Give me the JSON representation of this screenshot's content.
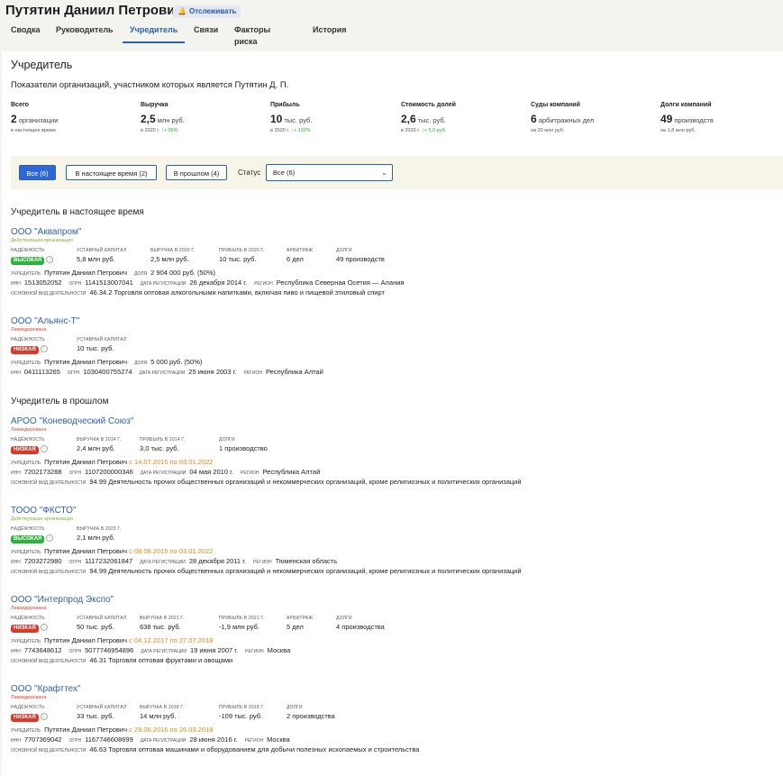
{
  "header": {
    "person_name": "Путятин Даниил Петрович",
    "follow_label": "Отслеживать"
  },
  "tabs": [
    {
      "label": "Сводка"
    },
    {
      "label": "Руководитель"
    },
    {
      "label": "Учредитель"
    },
    {
      "label": "Связи"
    },
    {
      "label": "Факторы риска"
    },
    {
      "label": "История"
    }
  ],
  "main": {
    "title": "Учредитель",
    "subtitle": "Показатели организаций, участником которых является Путятин Д. П.",
    "stats": [
      {
        "label": "Всего",
        "value": "2",
        "unit": "организации",
        "note": "в настоящее время",
        "delta": ""
      },
      {
        "label": "Выручка",
        "value": "2,5",
        "unit": "млн руб.",
        "note": "в 2020 г.",
        "delta": "+ 95%"
      },
      {
        "label": "Прибыль",
        "value": "10",
        "unit": "тыс. руб.",
        "note": "в 2020 г.",
        "delta": "+ 102%"
      },
      {
        "label": "Стоимость долей",
        "value": "2,6",
        "unit": "тыс. руб.",
        "note": "в 2020 г.",
        "delta": "+ 5,0 руб."
      },
      {
        "label": "Суды компаний",
        "value": "6",
        "unit": "арбитражных дел",
        "note": "на 20 млн руб.",
        "delta": ""
      },
      {
        "label": "Долги компаний",
        "value": "49",
        "unit": "производств",
        "note": "на 1,8 млн руб.",
        "delta": ""
      }
    ],
    "filters": {
      "all": "Все (6)",
      "current": "В настоящее время (2)",
      "past": "В прошлом (4)",
      "status_label": "Статус",
      "status_value": "Все (6)"
    },
    "current_title": "Учредитель в настоящее время",
    "past_title": "Учредитель в прошлом"
  },
  "labels": {
    "reliability": "Надёжность",
    "capital": "Уставный капитал",
    "arbitrage": "Арбитраж",
    "debts": "Долги",
    "founder": "Учредитель",
    "share": "Доля",
    "inn": "ИНН",
    "ogrn": "ОГРН",
    "reg_date": "Дата регистрации",
    "region": "Регион",
    "activity": "Основной вид деятельности"
  },
  "orgs": [
    {
      "name": "ООО \"Аквапром\"",
      "state": "Действующая организация",
      "badge": "ВЫСОКАЯ",
      "c1_label": "Уставный капитал",
      "c1": "5,8 млн руб.",
      "c2_label": "Выручка в 2020 г.",
      "c2": "2,5 млн руб.",
      "c3_label": "Прибыль в 2020 г.",
      "c3": "10 тыс. руб.",
      "c4_label": "Арбитраж",
      "c4": "6 дел",
      "c5_label": "Долги",
      "c5": "49 производств",
      "founder": "Путятин Даниил Петрович",
      "period": "",
      "share": "2 904 000 руб. (50%)",
      "inn": "1513052052",
      "ogrn": "1141513007041",
      "reg": "26 декабря 2014 г.",
      "region": "Республика Северная Осетия — Алания",
      "activity": "46.34.2 Торговля оптовая алкогольными напитками, включая пиво и пищевой этиловый спирт"
    },
    {
      "name": "ООО \"Альянс-Т\"",
      "state": "Ликвидирована",
      "badge": "НИЗКАЯ",
      "c1_label": "Уставный капитал",
      "c1": "10 тыс. руб.",
      "c2_label": "",
      "c2": "",
      "c3_label": "",
      "c3": "",
      "c4_label": "",
      "c4": "",
      "c5_label": "",
      "c5": "",
      "founder": "Путятин Даниил Петрович",
      "period": "",
      "share": "5 000 руб. (50%)",
      "inn": "0411113265",
      "ogrn": "1030400755274",
      "reg": "25 июня 2003 г.",
      "region": "Республика Алтай",
      "activity": ""
    },
    {
      "name": "АРОО \"Коневодческий Союз\"",
      "state": "Ликвидирована",
      "badge": "НИЗКАЯ",
      "c1_label": "Выручка в 2014 г.",
      "c1": "2,4 млн руб.",
      "c2_label": "Прибыль в 2014 г.",
      "c2": "3,0 тыс. руб.",
      "c3_label": "Долги",
      "c3": "1 производство",
      "c4_label": "",
      "c4": "",
      "c5_label": "",
      "c5": "",
      "founder": "Путятин Даниил Петрович",
      "period": "с 14.07.2015 по 03.01.2022",
      "share": "",
      "inn": "7202173288",
      "ogrn": "1107200000346",
      "reg": "04 мая 2010 г.",
      "region": "Республика Алтай",
      "activity": "94.99 Деятельность прочих общественных организаций и некоммерческих организаций, кроме религиозных и политических организаций"
    },
    {
      "name": "ТООО \"ФКСТО\"",
      "state": "Действующая организация",
      "badge": "ВЫСОКАЯ",
      "c1_label": "Выручка в 2023 г.",
      "c1": "2,1 млн руб.",
      "c2_label": "",
      "c2": "",
      "c3_label": "",
      "c3": "",
      "c4_label": "",
      "c4": "",
      "c5_label": "",
      "c5": "",
      "founder": "Путятин Даниил Петрович",
      "period": "с 08.08.2015 по 03.01.2022",
      "share": "",
      "inn": "7203272980",
      "ogrn": "1117232061847",
      "reg": "28 декабря 2011 г.",
      "region": "Тюменская область",
      "activity": "94.99 Деятельность прочих общественных организаций и некоммерческих организаций, кроме религиозных и политических организаций"
    },
    {
      "name": "ООО \"Интерпрод Экспо\"",
      "state": "Ликвидирована",
      "badge": "НИЗКАЯ",
      "c1_label": "Уставный капитал",
      "c1": "50 тыс. руб.",
      "c2_label": "Выручка в 2021 г.",
      "c2": "638 тыс. руб.",
      "c3_label": "Прибыль в 2021 г.",
      "c3": "-1,9 млн руб.",
      "c4_label": "Арбитраж",
      "c4": "5 дел",
      "c5_label": "Долги",
      "c5": "4 производства",
      "founder": "Путятин Даниил Петрович",
      "period": "с 04.12.2017 по 27.07.2018",
      "share": "",
      "inn": "7743648612",
      "ogrn": "5077746954896",
      "reg": "19 июня 2007 г.",
      "region": "Москва",
      "activity": "46.31 Торговля оптовая фруктами и овощами"
    },
    {
      "name": "ООО \"Крафттех\"",
      "state": "Ликвидирована",
      "badge": "НИЗКАЯ",
      "c1_label": "Уставный капитал",
      "c1": "33 тыс. руб.",
      "c2_label": "Выручка в 2018 г.",
      "c2": "14 млн руб.",
      "c3_label": "Прибыль в 2018 г.",
      "c3": "-109 тыс. руб.",
      "c4_label": "Долги",
      "c4": "2 производства",
      "c5_label": "",
      "c5": "",
      "founder": "Путятин Даниил Петрович",
      "period": "с 29.06.2016 по 26.03.2018",
      "share": "",
      "inn": "7707369042",
      "ogrn": "1167746608699",
      "reg": "28 июня 2016 г.",
      "region": "Москва",
      "activity": "46.63 Торговля оптовая машинами и оборудованием для добычи полезных ископаемых и строительства"
    }
  ]
}
